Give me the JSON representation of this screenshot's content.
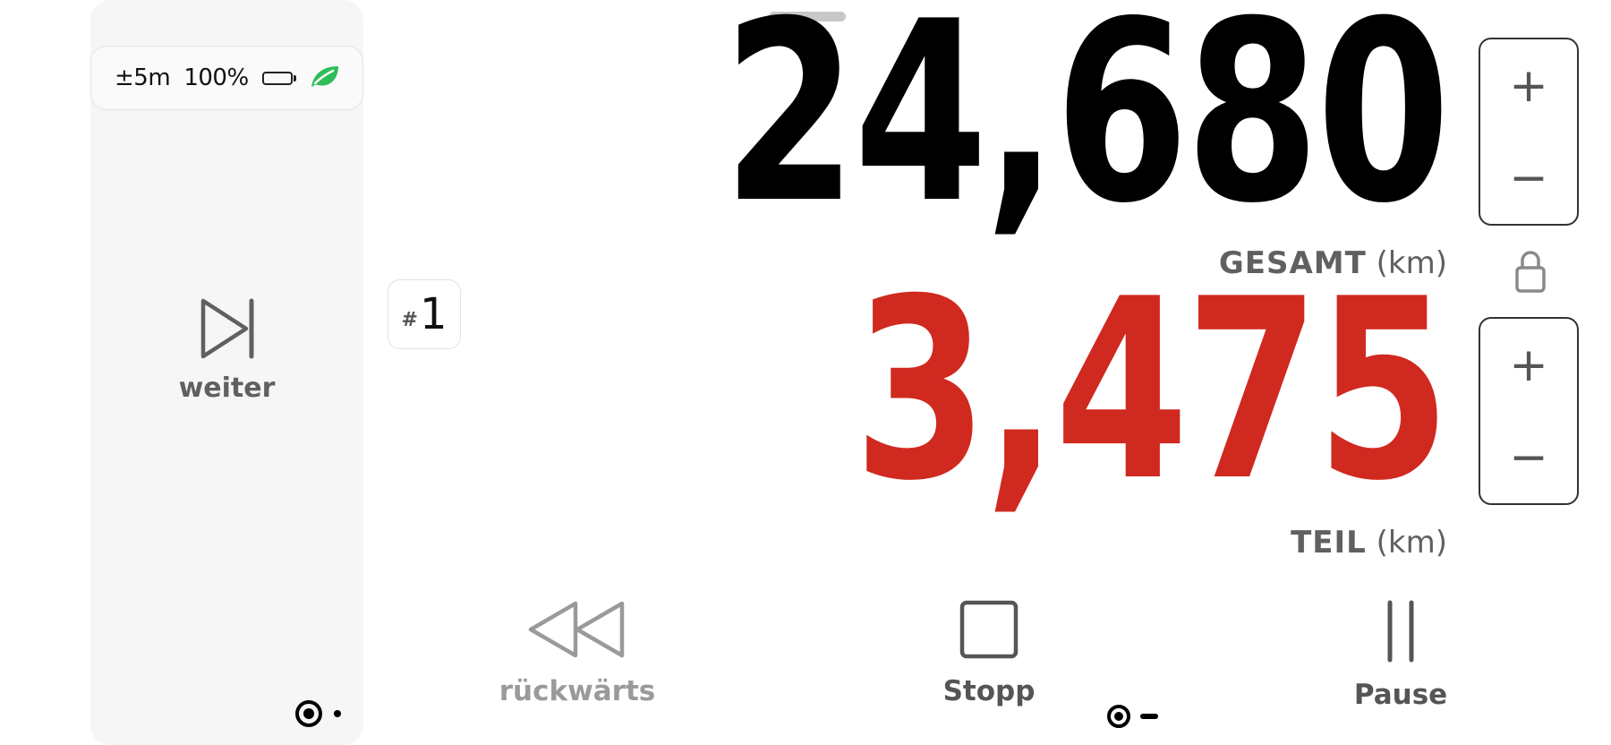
{
  "status": {
    "accuracy": "±5m",
    "battery": "100%",
    "battery_level": 1.0,
    "eco_color": "#2ebd5a",
    "icons": [
      "battery-icon",
      "leaf-icon"
    ]
  },
  "next_button": {
    "label": "weiter",
    "icon": "skip-next-icon"
  },
  "trip_badge": {
    "hash": "#",
    "number": "1"
  },
  "total": {
    "value": "24,680",
    "label": "GESAMT",
    "unit": "(km)",
    "color": "#000000"
  },
  "trip": {
    "value": "3,475",
    "label": "TEIL",
    "unit": "(km)",
    "color": "#d0291f"
  },
  "stepper": {
    "plus": "+",
    "minus": "−"
  },
  "controls": {
    "back": {
      "label": "rückwärts",
      "icon": "rewind-icon"
    },
    "stop": {
      "label": "Stopp",
      "icon": "stop-icon"
    },
    "pause": {
      "label": "Pause",
      "icon": "pause-icon"
    }
  },
  "lock_icon": "lock-icon"
}
